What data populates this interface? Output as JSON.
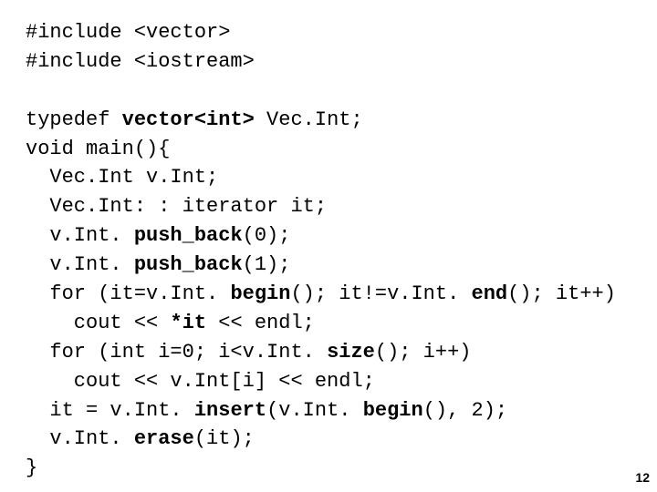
{
  "code": {
    "l01": "#include <vector>",
    "l02": "#include <iostream>",
    "l03": "",
    "l04a": "typedef ",
    "l04b": "vector<int>",
    "l04c": " Vec.Int;",
    "l05": "void main(){",
    "l06": "  Vec.Int v.Int;",
    "l07": "  Vec.Int: : iterator it;",
    "l08a": "  v.Int. ",
    "l08b": "push_back",
    "l08c": "(0);",
    "l09a": "  v.Int. ",
    "l09b": "push_back",
    "l09c": "(1);",
    "l10a": "  for (it=v.Int. ",
    "l10b": "begin",
    "l10c": "(); it!=v.Int. ",
    "l10d": "end",
    "l10e": "(); it++)",
    "l11a": "    cout << ",
    "l11b": "*it",
    "l11c": " << endl;",
    "l12a": "  for (int i=0; i<v.Int. ",
    "l12b": "size",
    "l12c": "(); i++)",
    "l13": "    cout << v.Int[i] << endl;",
    "l14a": "  it = v.Int. ",
    "l14b": "insert",
    "l14c": "(v.Int. ",
    "l14d": "begin",
    "l14e": "(), 2);",
    "l15a": "  v.Int. ",
    "l15b": "erase",
    "l15c": "(it);",
    "l16": "}"
  },
  "page_number": "12"
}
